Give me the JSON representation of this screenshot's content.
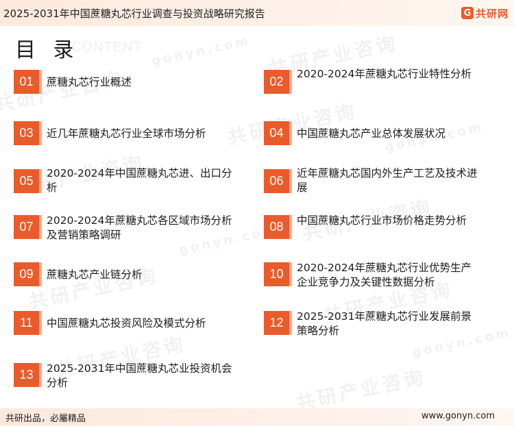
{
  "header": {
    "title": "2025-2031年中国蔗糖丸芯行业调查与投资战略研究报告",
    "brand_name": "共研网",
    "brand_mark": "G"
  },
  "toc": {
    "heading": "目 录",
    "subheading": "CONTENT",
    "items": [
      {
        "num": "01",
        "label": "蔗糖丸芯行业概述"
      },
      {
        "num": "02",
        "label": "2020-2024年蔗糖丸芯行业特性分析"
      },
      {
        "num": "03",
        "label": "近几年蔗糖丸芯行业全球市场分析"
      },
      {
        "num": "04",
        "label": "中国蔗糖丸芯产业总体发展状况"
      },
      {
        "num": "05",
        "label": "2020-2024年中国蔗糖丸芯进、出口分析"
      },
      {
        "num": "06",
        "label": "近年蔗糖丸芯国内外生产工艺及技术进展"
      },
      {
        "num": "07",
        "label": "2020-2024年蔗糖丸芯各区域市场分析及营销策略调研"
      },
      {
        "num": "08",
        "label": "中国蔗糖丸芯行业市场价格走势分析"
      },
      {
        "num": "09",
        "label": "蔗糖丸芯产业链分析"
      },
      {
        "num": "10",
        "label": "2020-2024年蔗糖丸芯行业优势生产企业竞争力及关键性数据分析"
      },
      {
        "num": "11",
        "label": "中国蔗糖丸芯投资风险及模式分析"
      },
      {
        "num": "12",
        "label": "2025-2031年蔗糖丸芯行业发展前景策略分析"
      },
      {
        "num": "13",
        "label": "2025-2031年中国蔗糖丸芯业投资机会分析"
      }
    ]
  },
  "watermark": {
    "text": "共研产业咨询",
    "url_text": "gonyn.com"
  },
  "footer": {
    "slogan": "共研出品，必屬精品",
    "website": "www.gonyn.com"
  },
  "colors": {
    "accent": "#ea5b2c",
    "accent_light": "#f7a98a",
    "band": "#fde9dd"
  }
}
